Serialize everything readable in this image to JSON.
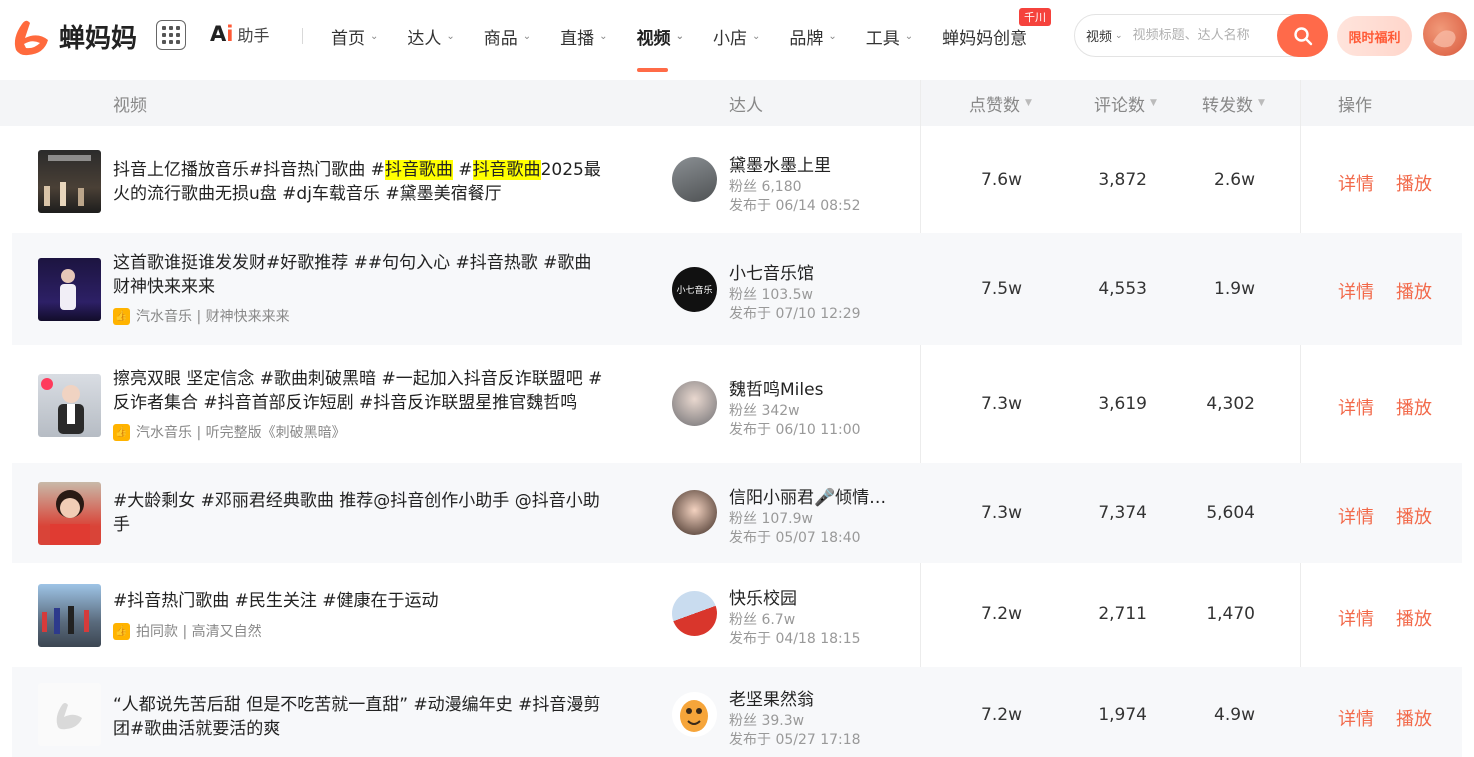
{
  "brand": {
    "name": "蝉妈妈"
  },
  "ai": {
    "logo_a": "A",
    "logo_i": "i",
    "label": "助手"
  },
  "nav": {
    "items": [
      {
        "label": "首页",
        "chevron": true
      },
      {
        "label": "达人",
        "chevron": true
      },
      {
        "label": "商品",
        "chevron": true
      },
      {
        "label": "直播",
        "chevron": true
      },
      {
        "label": "视频",
        "chevron": true,
        "active": true
      },
      {
        "label": "小店",
        "chevron": true
      },
      {
        "label": "品牌",
        "chevron": true
      },
      {
        "label": "工具",
        "chevron": true
      },
      {
        "label": "蝉妈妈创意",
        "chevron": false
      }
    ],
    "badge": "千川"
  },
  "search": {
    "type": "视频",
    "placeholder": "视频标题、达人名称"
  },
  "promo": {
    "label": "限时福利"
  },
  "table": {
    "headers": {
      "video": "视频",
      "kol": "达人",
      "likes": "点赞数",
      "comments": "评论数",
      "shares": "转发数",
      "ops": "操作"
    },
    "rows": [
      {
        "title_parts": [
          "抖音上亿播放音乐#抖音热门歌曲 #",
          "抖音歌曲",
          " #",
          "抖音歌曲",
          "2025最火的流行歌曲无损u盘 #dj车载音乐 #黛墨美宿餐厅"
        ],
        "tag": "",
        "kol_name": "黛墨水墨上里",
        "fans": "粉丝 6,180",
        "published": "发布于 06/14 08:52",
        "likes": "7.6w",
        "comments": "3,872",
        "shares": "2.6w"
      },
      {
        "title_parts": [
          "这首歌谁挺谁发发财#好歌推荐 ##句句入心 #抖音热歌 #歌曲财神快来来来"
        ],
        "tag": "汽水音乐 | 财神快来来来",
        "kol_name": "小七音乐馆",
        "kol_avatar_text": "小七音乐",
        "fans": "粉丝 103.5w",
        "published": "发布于 07/10 12:29",
        "likes": "7.5w",
        "comments": "4,553",
        "shares": "1.9w"
      },
      {
        "title_parts": [
          "擦亮双眼 坚定信念 #歌曲刺破黑暗 #一起加入抖音反诈联盟吧 #反诈者集合 #抖音首部反诈短剧 #抖音反诈联盟星推官魏哲鸣"
        ],
        "tag": "汽水音乐 | 听完整版《刺破黑暗》",
        "kol_name": "魏哲鸣Miles",
        "fans": "粉丝 342w",
        "published": "发布于 06/10 11:00",
        "likes": "7.3w",
        "comments": "3,619",
        "shares": "4,302"
      },
      {
        "title_parts": [
          "#大龄剩女 #邓丽君经典歌曲 推荐@抖音创作小助手 @抖音小助手"
        ],
        "tag": "",
        "kol_name": "信阳小丽君🎤倾情…",
        "fans": "粉丝 107.9w",
        "published": "发布于 05/07 18:40",
        "likes": "7.3w",
        "comments": "7,374",
        "shares": "5,604"
      },
      {
        "title_parts": [
          "#抖音热门歌曲 #民生关注 #健康在于运动"
        ],
        "tag": "拍同款 | 高清又自然",
        "kol_name": "快乐校园",
        "fans": "粉丝 6.7w",
        "published": "发布于 04/18 18:15",
        "likes": "7.2w",
        "comments": "2,711",
        "shares": "1,470"
      },
      {
        "title_parts": [
          "“人都说先苦后甜 但是不吃苦就一直甜” #动漫编年史 #抖音漫剪团#歌曲活就要活的爽"
        ],
        "tag": "",
        "kol_name": "老坚果然翁",
        "fans": "粉丝 39.3w",
        "published": "发布于 05/27 17:18",
        "likes": "7.2w",
        "comments": "1,974",
        "shares": "4.9w"
      }
    ],
    "op_detail": "详情",
    "op_play": "播放"
  },
  "colors": {
    "accent": "#ff6a4a",
    "op_link": "#f26a4b",
    "highlight": "#ffff00",
    "badge": "#f5423c"
  }
}
